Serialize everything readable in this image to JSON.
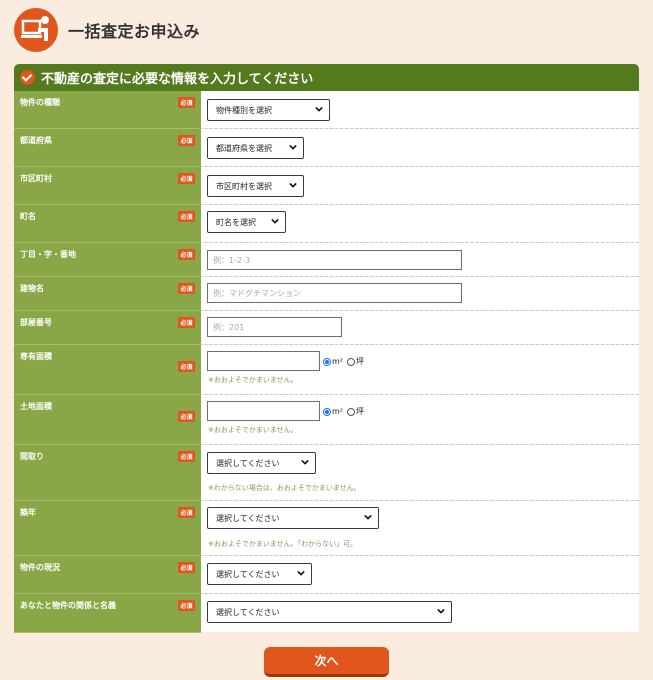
{
  "page": {
    "title": "一括査定お申込み"
  },
  "panel": {
    "title": "不動産の査定に必要な情報を入力してください"
  },
  "required_badge": "必須",
  "fields": {
    "property_type": {
      "label": "物件の種類",
      "selected": "物件種別を選択"
    },
    "prefecture": {
      "label": "都道府県",
      "selected": "都道府県を選択"
    },
    "city": {
      "label": "市区町村",
      "selected": "市区町村を選択"
    },
    "town": {
      "label": "町名",
      "selected": "町名を選択"
    },
    "chome": {
      "label": "丁目・字・番地",
      "placeholder": "例：1-2-3"
    },
    "building": {
      "label": "建物名",
      "placeholder": "例：マドグチマンション"
    },
    "room": {
      "label": "部屋番号",
      "placeholder": "例：201"
    },
    "floor_area": {
      "label": "専有面積",
      "value": "",
      "unit_m2": "m²",
      "unit_tsubo": "坪",
      "note": "※おおよそでかまいません。"
    },
    "land_area": {
      "label": "土地面積",
      "value": "",
      "unit_m2": "m²",
      "unit_tsubo": "坪",
      "note": "※おおよそでかまいません。"
    },
    "layout": {
      "label": "間取り",
      "selected": "選択してください",
      "note": "※わからない場合は、おおよそでかまいません。"
    },
    "age": {
      "label": "築年",
      "selected": "選択してください",
      "note": "※おおよそでかまいません。「わからない」可。"
    },
    "status": {
      "label": "物件の現況",
      "selected": "選択してください"
    },
    "relation": {
      "label": "あなたと物件の関係と名義",
      "selected": "選択してください"
    }
  },
  "next_button": "次へ",
  "colors": {
    "accent": "#e0561c",
    "header_green": "#537a1c",
    "label_green": "#8aa747",
    "background": "#fbece0"
  }
}
